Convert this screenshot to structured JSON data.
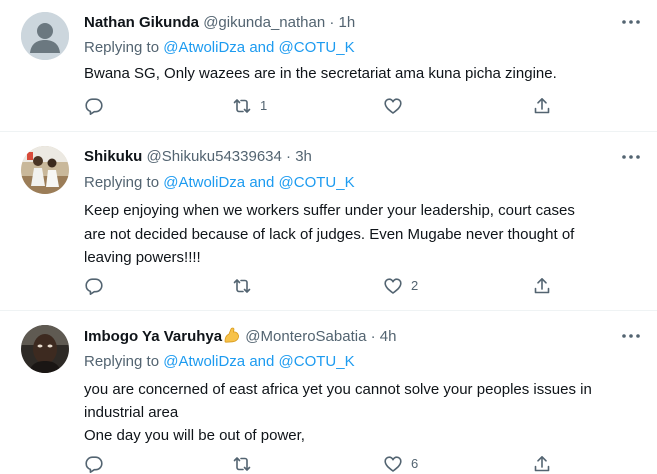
{
  "tweets": [
    {
      "name": "Nathan Gikunda",
      "handle": "@gikunda_nathan",
      "separator": "·",
      "time": "1h",
      "replying_label": "Replying to",
      "mention1": "@AtwoliDza",
      "and_text": "and",
      "mention2": "@COTU_K",
      "lines": [
        "Bwana SG, Only wazees are in the secretariat ama kuna picha zingine."
      ],
      "reply_count": "",
      "retweet_count": "1",
      "like_count": "",
      "avatar": "default-avatar",
      "more_icon": "more-icon"
    },
    {
      "name": "Shikuku",
      "handle": "@Shikuku54339634",
      "separator": "·",
      "time": "3h",
      "replying_label": "Replying to",
      "mention1": "@AtwoliDza",
      "and_text": "and",
      "mention2": "@COTU_K",
      "lines": [
        "Keep enjoying when we workers suffer under your leadership, court cases",
        "are not decided because of lack of judges. Even Mugabe never thought of",
        "leaving powers!!!!"
      ],
      "reply_count": "",
      "retweet_count": "",
      "like_count": "2",
      "avatar": "photo-avatar",
      "more_icon": "more-icon"
    },
    {
      "name": "Imbogo Ya Varuhya",
      "name_emoji": "flexed-biceps-emoji",
      "handle": "@MonteroSabatia",
      "separator": "·",
      "time": "4h",
      "replying_label": "Replying to",
      "mention1": "@AtwoliDza",
      "and_text": "and",
      "mention2": "@COTU_K",
      "lines": [
        "you are concerned of east africa yet you cannot solve your peoples issues in",
        "industrial area",
        "One day you will be out of power,"
      ],
      "reply_count": "",
      "retweet_count": "",
      "like_count": "6",
      "avatar": "photo-avatar",
      "more_icon": "more-icon"
    }
  ],
  "colors": {
    "text": "#0f1419",
    "secondary": "#536471",
    "link": "#1d9bf0",
    "divider": "#eff3f4"
  }
}
